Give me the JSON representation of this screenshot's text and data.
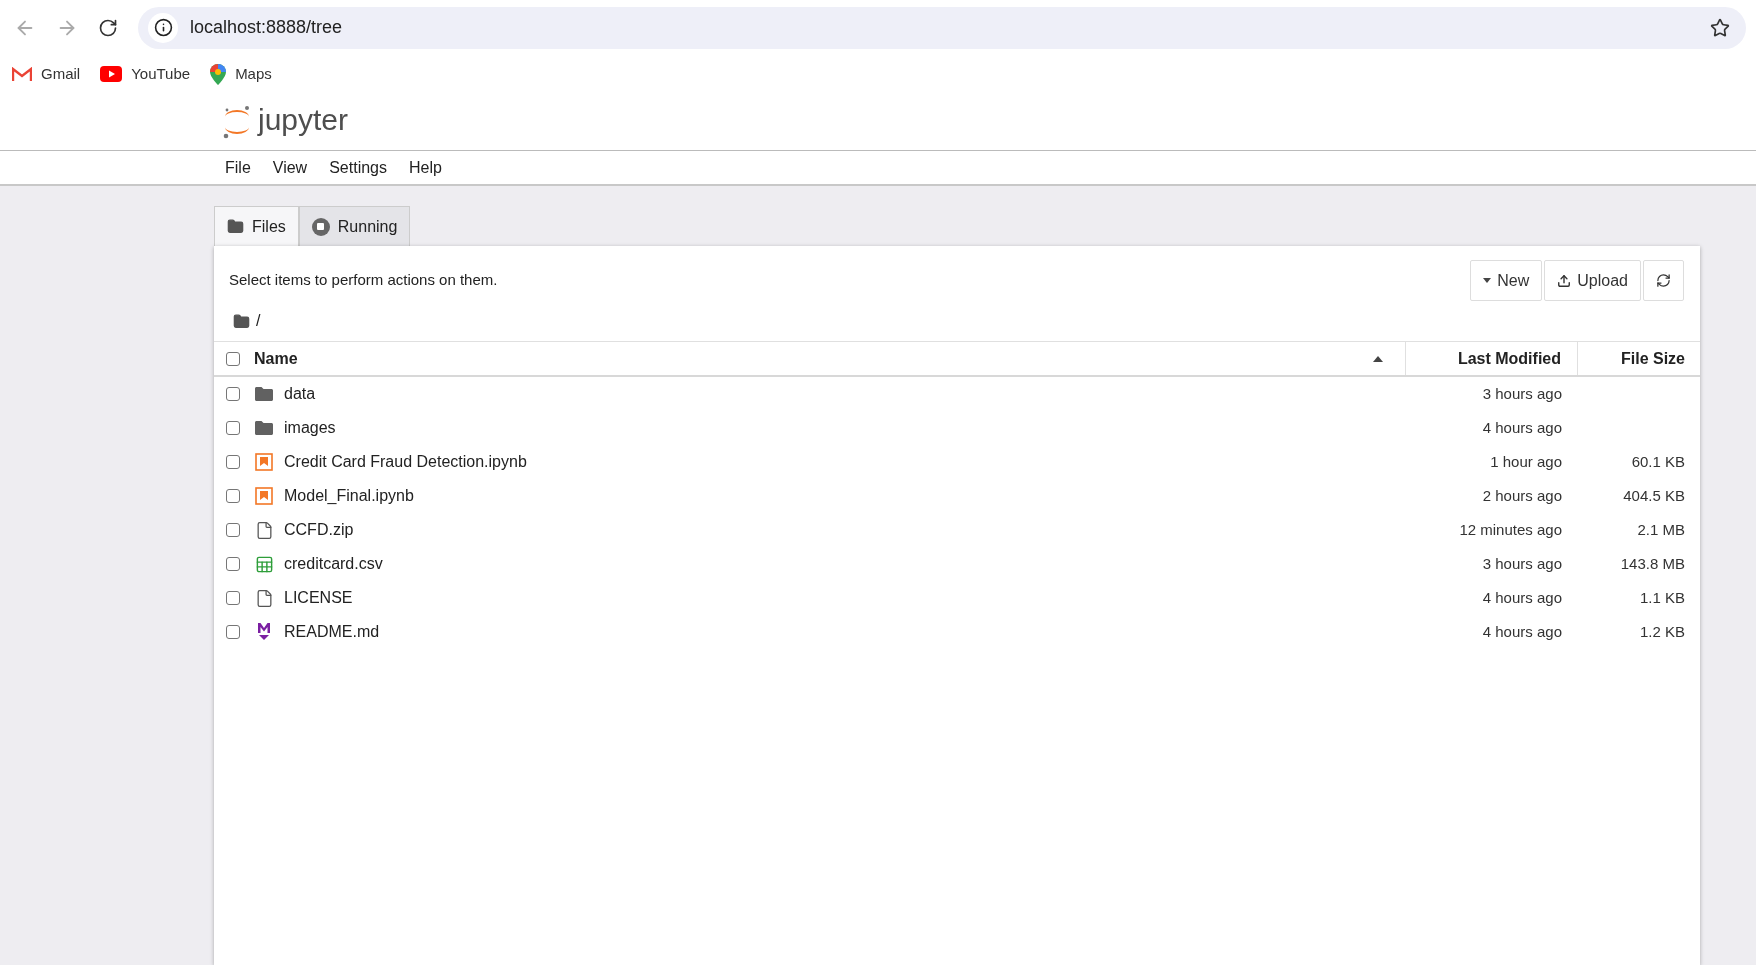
{
  "browser": {
    "url": "localhost:8888/tree",
    "bookmarks": [
      {
        "label": "Gmail",
        "kind": "gmail"
      },
      {
        "label": "YouTube",
        "kind": "youtube"
      },
      {
        "label": "Maps",
        "kind": "maps"
      }
    ]
  },
  "app": {
    "logo_text": "jupyter",
    "menu": [
      "File",
      "View",
      "Settings",
      "Help"
    ]
  },
  "tabs": [
    {
      "label": "Files",
      "selected": true,
      "kind": "files"
    },
    {
      "label": "Running",
      "selected": false,
      "kind": "running"
    }
  ],
  "toolbar": {
    "hint": "Select items to perform actions on them.",
    "buttons": [
      {
        "label": "New",
        "kind": "new"
      },
      {
        "label": "Upload",
        "kind": "upload"
      },
      {
        "kind": "refresh"
      }
    ]
  },
  "breadcrumb": "/",
  "table": {
    "select_all_checked": false,
    "columns": [
      "Name",
      "Last Modified",
      "File Size"
    ],
    "rows": [
      {
        "name": "data",
        "kind": "folder",
        "modified": "3 hours ago",
        "checked": false
      },
      {
        "name": "images",
        "kind": "folder",
        "modified": "4 hours ago",
        "checked": false
      },
      {
        "name": "Credit Card Fraud Detection.ipynb",
        "kind": "notebook",
        "modified": "1 hour ago",
        "size": "60.1 KB",
        "checked": false
      },
      {
        "name": "Model_Final.ipynb",
        "kind": "notebook",
        "modified": "2 hours ago",
        "size": "404.5 KB",
        "checked": false
      },
      {
        "name": "CCFD.zip",
        "kind": "file",
        "modified": "12 minutes ago",
        "size": "2.1 MB",
        "checked": false
      },
      {
        "name": "creditcard.csv",
        "kind": "csv",
        "modified": "3 hours ago",
        "size": "143.8 MB",
        "checked": false
      },
      {
        "name": "LICENSE",
        "kind": "file",
        "modified": "4 hours ago",
        "size": "1.1 KB",
        "checked": false
      },
      {
        "name": "README.md",
        "kind": "markdown",
        "modified": "4 hours ago",
        "size": "1.2 KB",
        "checked": false
      }
    ]
  }
}
